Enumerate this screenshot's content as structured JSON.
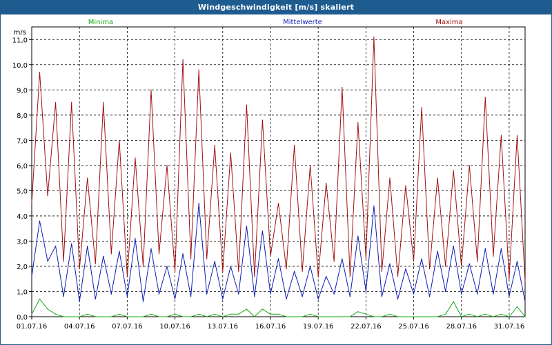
{
  "window": {
    "title": "Windgeschwindigkeit [m/s] skaliert"
  },
  "colors": {
    "min": "#12a812",
    "mean": "#0b1cb5",
    "max": "#a01010",
    "grid": "#000000",
    "titlebar": "#1e5b8f"
  },
  "chart_data": {
    "type": "line",
    "ylabel": "m/s",
    "ylim": [
      0,
      11.5
    ],
    "yticks": [
      "0,0",
      "1,0",
      "2,0",
      "3,0",
      "4,0",
      "5,0",
      "6,0",
      "7,0",
      "8,0",
      "9,0",
      "10,0",
      "11,0"
    ],
    "ytick_values": [
      0,
      1,
      2,
      3,
      4,
      5,
      6,
      7,
      8,
      9,
      10,
      11
    ],
    "xlim_days": [
      1,
      32
    ],
    "xtick_days": [
      1,
      4,
      7,
      10,
      13,
      16,
      19,
      22,
      25,
      28,
      31
    ],
    "xticks": [
      "01.07.16",
      "04.07.16",
      "07.07.16",
      "10.07.16",
      "13.07.16",
      "16.07.16",
      "19.07.16",
      "22.07.16",
      "25.07.16",
      "28.07.16",
      "31.07.16"
    ],
    "grid": true,
    "legend_position": "top",
    "series": [
      {
        "name": "Minima",
        "color": "#12a812",
        "x": [
          "01.07.16 00:00",
          "01.07.16 12:00",
          "02.07.16 00:00",
          "02.07.16 12:00",
          "03.07.16 00:00",
          "03.07.16 12:00",
          "04.07.16 00:00",
          "04.07.16 12:00",
          "05.07.16 00:00",
          "05.07.16 12:00",
          "06.07.16 00:00",
          "06.07.16 12:00",
          "07.07.16 00:00",
          "07.07.16 12:00",
          "08.07.16 00:00",
          "08.07.16 12:00",
          "09.07.16 00:00",
          "09.07.16 12:00",
          "10.07.16 00:00",
          "10.07.16 12:00",
          "11.07.16 00:00",
          "11.07.16 12:00",
          "12.07.16 00:00",
          "12.07.16 12:00",
          "13.07.16 00:00",
          "13.07.16 12:00",
          "14.07.16 00:00",
          "14.07.16 12:00",
          "15.07.16 00:00",
          "15.07.16 12:00",
          "16.07.16 00:00",
          "16.07.16 12:00",
          "17.07.16 00:00",
          "17.07.16 12:00",
          "18.07.16 00:00",
          "18.07.16 12:00",
          "19.07.16 00:00",
          "19.07.16 12:00",
          "20.07.16 00:00",
          "20.07.16 12:00",
          "21.07.16 00:00",
          "21.07.16 12:00",
          "22.07.16 00:00",
          "22.07.16 12:00",
          "23.07.16 00:00",
          "23.07.16 12:00",
          "24.07.16 00:00",
          "24.07.16 12:00",
          "25.07.16 00:00",
          "25.07.16 12:00",
          "26.07.16 00:00",
          "26.07.16 12:00",
          "27.07.16 00:00",
          "27.07.16 12:00",
          "28.07.16 00:00",
          "28.07.16 12:00",
          "29.07.16 00:00",
          "29.07.16 12:00",
          "30.07.16 00:00",
          "30.07.16 12:00",
          "31.07.16 00:00",
          "31.07.16 12:00",
          "01.08.16 00:00"
        ],
        "y": [
          0.1,
          0.7,
          0.3,
          0.1,
          0.0,
          0.0,
          0.0,
          0.1,
          0.0,
          0.0,
          0.0,
          0.1,
          0.0,
          0.0,
          0.0,
          0.1,
          0.0,
          0.0,
          0.1,
          0.0,
          0.0,
          0.1,
          0.0,
          0.1,
          0.0,
          0.1,
          0.1,
          0.3,
          0.0,
          0.3,
          0.1,
          0.1,
          0.0,
          0.0,
          0.0,
          0.1,
          0.0,
          0.0,
          0.0,
          0.0,
          0.0,
          0.2,
          0.1,
          0.0,
          0.0,
          0.1,
          0.0,
          0.0,
          0.0,
          0.0,
          0.0,
          0.0,
          0.1,
          0.6,
          0.0,
          0.1,
          0.0,
          0.1,
          0.0,
          0.1,
          0.0,
          0.4,
          0.0
        ]
      },
      {
        "name": "Mittelwerte",
        "color": "#0b1cb5",
        "x": [
          "01.07.16 00:00",
          "01.07.16 12:00",
          "02.07.16 00:00",
          "02.07.16 12:00",
          "03.07.16 00:00",
          "03.07.16 12:00",
          "04.07.16 00:00",
          "04.07.16 12:00",
          "05.07.16 00:00",
          "05.07.16 12:00",
          "06.07.16 00:00",
          "06.07.16 12:00",
          "07.07.16 00:00",
          "07.07.16 12:00",
          "08.07.16 00:00",
          "08.07.16 12:00",
          "09.07.16 00:00",
          "09.07.16 12:00",
          "10.07.16 00:00",
          "10.07.16 12:00",
          "11.07.16 00:00",
          "11.07.16 12:00",
          "12.07.16 00:00",
          "12.07.16 12:00",
          "13.07.16 00:00",
          "13.07.16 12:00",
          "14.07.16 00:00",
          "14.07.16 12:00",
          "15.07.16 00:00",
          "15.07.16 12:00",
          "16.07.16 00:00",
          "16.07.16 12:00",
          "17.07.16 00:00",
          "17.07.16 12:00",
          "18.07.16 00:00",
          "18.07.16 12:00",
          "19.07.16 00:00",
          "19.07.16 12:00",
          "20.07.16 00:00",
          "20.07.16 12:00",
          "21.07.16 00:00",
          "21.07.16 12:00",
          "22.07.16 00:00",
          "22.07.16 12:00",
          "23.07.16 00:00",
          "23.07.16 12:00",
          "24.07.16 00:00",
          "24.07.16 12:00",
          "25.07.16 00:00",
          "25.07.16 12:00",
          "26.07.16 00:00",
          "26.07.16 12:00",
          "27.07.16 00:00",
          "27.07.16 12:00",
          "28.07.16 00:00",
          "28.07.16 12:00",
          "29.07.16 00:00",
          "29.07.16 12:00",
          "30.07.16 00:00",
          "30.07.16 12:00",
          "31.07.16 00:00",
          "31.07.16 12:00",
          "01.08.16 00:00"
        ],
        "y": [
          1.6,
          3.8,
          2.2,
          2.8,
          0.8,
          2.9,
          0.6,
          2.8,
          0.7,
          2.4,
          0.9,
          2.6,
          0.8,
          3.1,
          0.6,
          2.7,
          0.9,
          2.0,
          0.7,
          2.5,
          0.8,
          4.5,
          0.9,
          2.2,
          0.7,
          2.0,
          0.9,
          3.6,
          0.8,
          3.4,
          0.9,
          2.3,
          0.7,
          1.8,
          0.8,
          2.0,
          0.7,
          1.6,
          0.9,
          2.3,
          0.8,
          3.2,
          1.0,
          4.4,
          0.8,
          2.1,
          0.7,
          1.9,
          0.9,
          2.3,
          0.8,
          2.6,
          1.0,
          2.8,
          0.9,
          2.1,
          0.9,
          2.7,
          0.9,
          2.7,
          0.8,
          2.2,
          0.6
        ]
      },
      {
        "name": "Maxima",
        "color": "#a01010",
        "x": [
          "01.07.16 00:00",
          "01.07.16 12:00",
          "02.07.16 00:00",
          "02.07.16 12:00",
          "03.07.16 00:00",
          "03.07.16 12:00",
          "04.07.16 00:00",
          "04.07.16 12:00",
          "05.07.16 00:00",
          "05.07.16 12:00",
          "06.07.16 00:00",
          "06.07.16 12:00",
          "07.07.16 00:00",
          "07.07.16 12:00",
          "08.07.16 00:00",
          "08.07.16 12:00",
          "09.07.16 00:00",
          "09.07.16 12:00",
          "10.07.16 00:00",
          "10.07.16 12:00",
          "11.07.16 00:00",
          "11.07.16 12:00",
          "12.07.16 00:00",
          "12.07.16 12:00",
          "13.07.16 00:00",
          "13.07.16 12:00",
          "14.07.16 00:00",
          "14.07.16 12:00",
          "15.07.16 00:00",
          "15.07.16 12:00",
          "16.07.16 00:00",
          "16.07.16 12:00",
          "17.07.16 00:00",
          "17.07.16 12:00",
          "18.07.16 00:00",
          "18.07.16 12:00",
          "19.07.16 00:00",
          "19.07.16 12:00",
          "20.07.16 00:00",
          "20.07.16 12:00",
          "21.07.16 00:00",
          "21.07.16 12:00",
          "22.07.16 00:00",
          "22.07.16 12:00",
          "23.07.16 00:00",
          "23.07.16 12:00",
          "24.07.16 00:00",
          "24.07.16 12:00",
          "25.07.16 00:00",
          "25.07.16 12:00",
          "26.07.16 00:00",
          "26.07.16 12:00",
          "27.07.16 00:00",
          "27.07.16 12:00",
          "28.07.16 00:00",
          "28.07.16 12:00",
          "29.07.16 00:00",
          "29.07.16 12:00",
          "30.07.16 00:00",
          "30.07.16 12:00",
          "31.07.16 00:00",
          "31.07.16 12:00",
          "01.08.16 00:00"
        ],
        "y": [
          4.5,
          9.7,
          4.8,
          8.5,
          2.2,
          8.5,
          1.9,
          5.5,
          2.1,
          8.5,
          2.5,
          7.0,
          1.6,
          6.3,
          2.0,
          9.0,
          2.5,
          6.0,
          1.8,
          10.2,
          2.3,
          9.8,
          2.3,
          6.8,
          1.8,
          6.5,
          1.8,
          8.4,
          1.6,
          7.8,
          2.4,
          4.5,
          1.9,
          6.8,
          1.8,
          6.0,
          1.6,
          5.3,
          2.2,
          9.1,
          1.6,
          7.7,
          2.3,
          11.1,
          1.8,
          5.5,
          1.6,
          5.2,
          2.2,
          8.3,
          1.9,
          5.5,
          2.0,
          5.8,
          2.0,
          6.0,
          2.2,
          8.7,
          2.4,
          7.2,
          1.5,
          7.2,
          1.4
        ]
      }
    ]
  }
}
